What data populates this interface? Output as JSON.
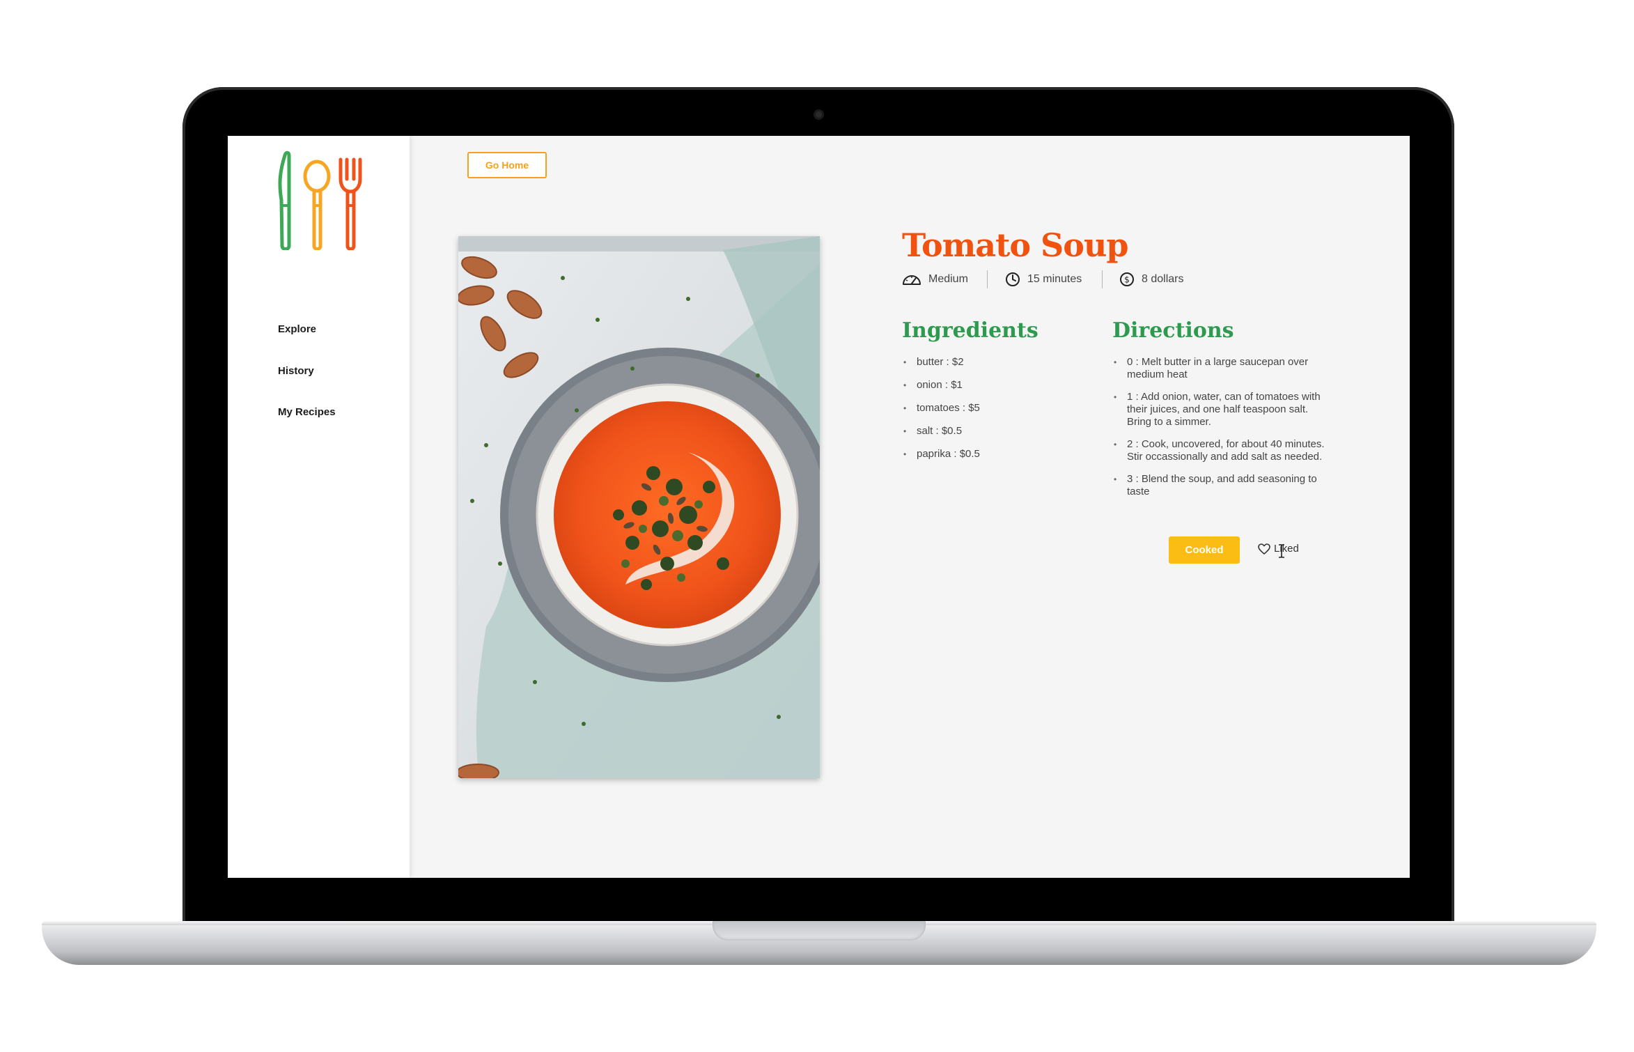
{
  "sidebar": {
    "nav": [
      {
        "label": "Explore"
      },
      {
        "label": "History"
      },
      {
        "label": "My Recipes"
      }
    ]
  },
  "header": {
    "go_home_label": "Go Home"
  },
  "recipe": {
    "title": "Tomato Soup",
    "meta": {
      "difficulty": "Medium",
      "time": "15 minutes",
      "cost": "8 dollars"
    },
    "ingredients_heading": "Ingredients",
    "ingredients": [
      "butter : $2",
      "onion : $1",
      "tomatoes : $5",
      "salt : $0.5",
      "paprika : $0.5"
    ],
    "directions_heading": "Directions",
    "directions": [
      "0 : Melt butter in a large saucepan over medium heat",
      "1 : Add onion, water, can of tomatoes with their juices, and one half teaspoon salt. Bring to a simmer.",
      "2 : Cook, uncovered, for about 40 minutes. Stir occassionally and add salt as needed.",
      "3 : Blend the soup, and add seasoning to taste"
    ]
  },
  "actions": {
    "cooked_label": "Cooked",
    "liked_label": "Liked"
  },
  "icons": {
    "difficulty": "speedometer-icon",
    "time": "clock-icon",
    "cost": "dollar-coin-icon",
    "like": "heart-outline-icon",
    "cursor": "text-cursor-icon"
  },
  "colors": {
    "accent_orange": "#f0520f",
    "heading_green": "#2e9a4f",
    "button_yellow": "#fbbc13",
    "go_home_orange": "#f4a21d",
    "logo_green": "#3da856",
    "logo_yellow": "#f6a623",
    "logo_orange": "#f0521b"
  }
}
